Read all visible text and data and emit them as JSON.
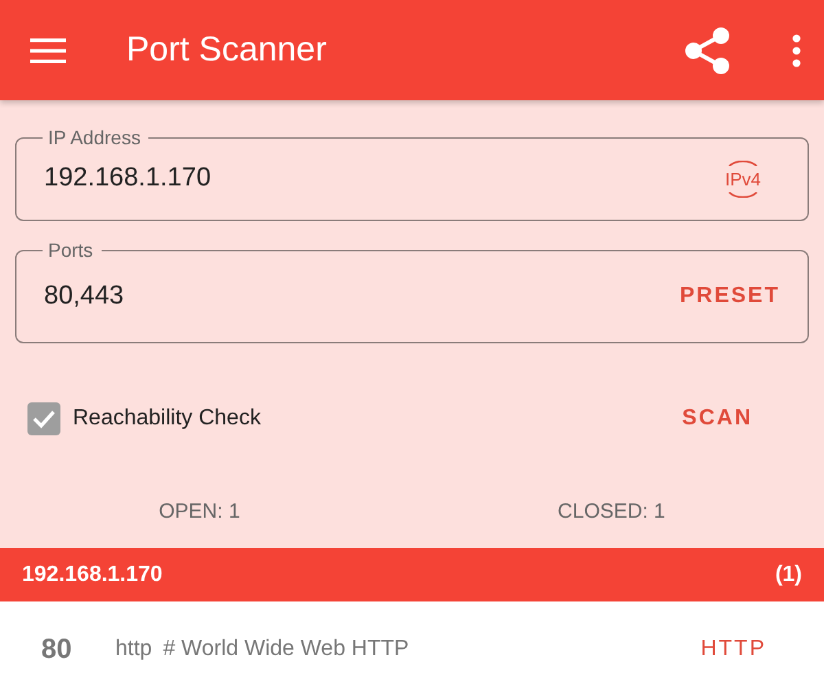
{
  "app_bar": {
    "title": "Port Scanner"
  },
  "ip_field": {
    "label": "IP Address",
    "value": "192.168.1.170",
    "action": "IPv4"
  },
  "ports_field": {
    "label": "Ports",
    "value": "80,443",
    "action": "PRESET"
  },
  "reachability": {
    "label": "Reachability Check",
    "checked": true
  },
  "scan_button": "SCAN",
  "counts": {
    "open": "OPEN: 1",
    "closed": "CLOSED: 1"
  },
  "results": [
    {
      "host": "192.168.1.170",
      "count": "(1)",
      "ports": [
        {
          "port": "80",
          "service": "http",
          "description": "# World Wide Web HTTP",
          "action": "HTTP"
        }
      ]
    }
  ]
}
